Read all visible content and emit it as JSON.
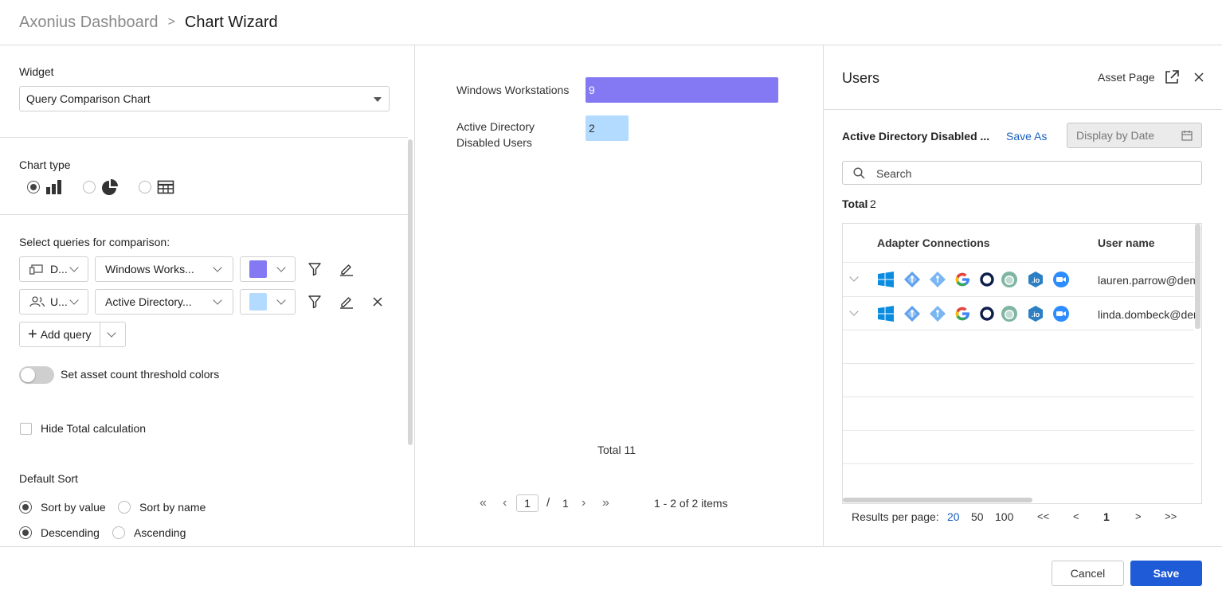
{
  "breadcrumb": {
    "root": "Axonius Dashboard",
    "separator": ">",
    "current": "Chart Wizard"
  },
  "left": {
    "widget_label": "Widget",
    "widget_value": "Query Comparison Chart",
    "chart_type_label": "Chart type",
    "chart_types": [
      {
        "name": "bar",
        "selected": true
      },
      {
        "name": "pie",
        "selected": false
      },
      {
        "name": "table",
        "selected": false
      }
    ],
    "queries_label": "Select queries for comparison:",
    "queries": [
      {
        "module": "D...",
        "query": "Windows Works...",
        "color": "#8479f2"
      },
      {
        "module": "U...",
        "query": "Active Directory...",
        "color": "#b3dbff"
      }
    ],
    "add_query_label": "Add query",
    "threshold_label": "Set asset count threshold colors",
    "hide_total_label": "Hide Total calculation",
    "default_sort_label": "Default Sort",
    "sort_by_value": "Sort by value",
    "sort_by_name": "Sort by name",
    "descending": "Descending",
    "ascending": "Ascending"
  },
  "chart_data": {
    "type": "bar",
    "orientation": "horizontal",
    "categories": [
      "Windows Workstations",
      "Active Directory Disabled Users"
    ],
    "values": [
      9,
      2
    ],
    "colors": [
      "#8479f2",
      "#b3dbff"
    ],
    "total_label": "Total 11"
  },
  "pager": {
    "first": "«",
    "prev": "‹",
    "page": "1",
    "slash": "/",
    "pages": "1",
    "next": "›",
    "last": "»",
    "items": "1 - 2 of 2 items"
  },
  "right": {
    "title": "Users",
    "asset_page": "Asset Page",
    "query_name": "Active Directory Disabled ...",
    "save_as": "Save As",
    "display_by_date": "Display by Date",
    "search_placeholder": "Search",
    "total_label": "Total",
    "total_value": "2",
    "columns": [
      "Adapter Connections",
      "User name"
    ],
    "rows": [
      {
        "user": "lauren.parrow@dem"
      },
      {
        "user": "linda.dombeck@der"
      }
    ],
    "adapters": [
      "windows-icon",
      "azure-ad-icon",
      "azure-icon",
      "google-icon",
      "okta-icon",
      "onelogin-icon",
      "io-icon",
      "zoom-icon"
    ],
    "results_per_page_label": "Results per page:",
    "page_sizes": [
      "20",
      "50",
      "100"
    ],
    "pg_first": "<<",
    "pg_prev": "<",
    "pg_current": "1",
    "pg_next": ">",
    "pg_last": ">>"
  },
  "footer": {
    "cancel": "Cancel",
    "save": "Save"
  },
  "colors": {
    "accent": "#1f5bd6",
    "link": "#1a5fbf"
  }
}
